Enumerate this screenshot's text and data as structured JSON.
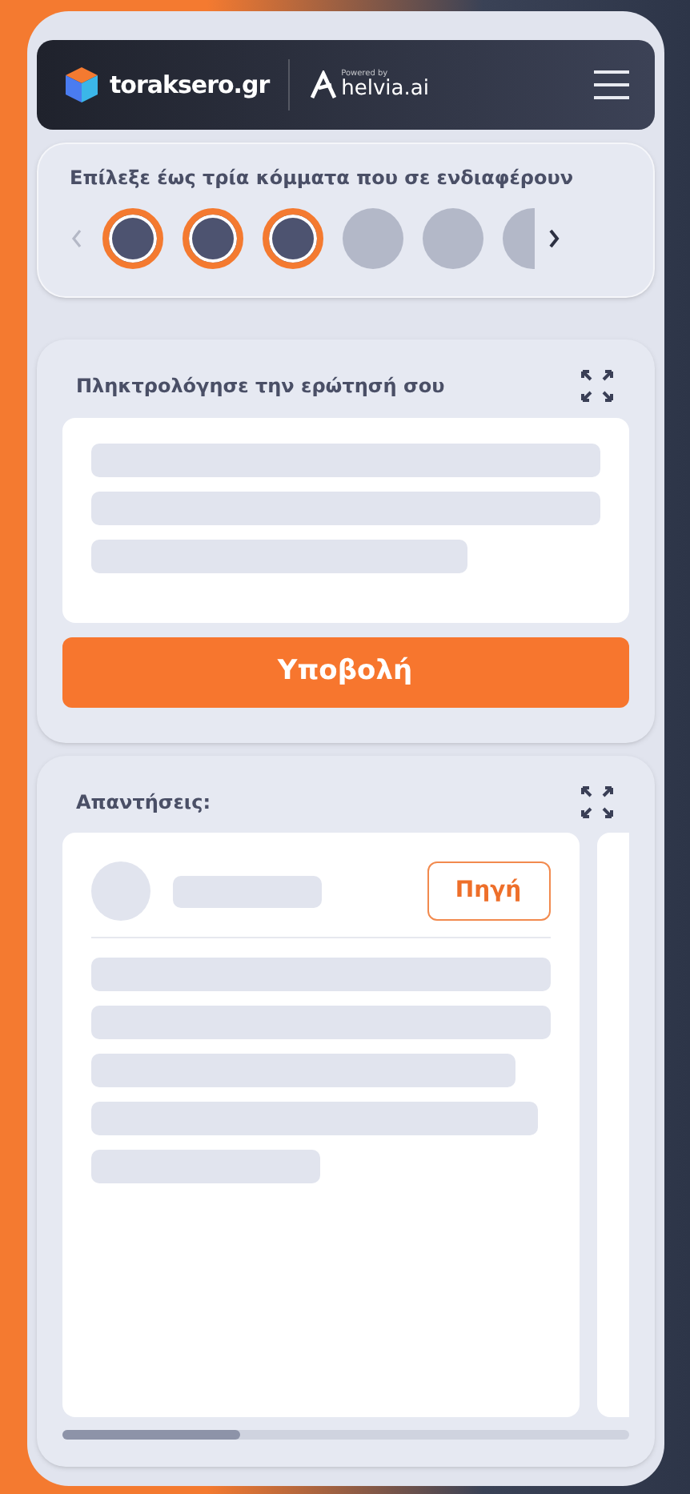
{
  "header": {
    "brand": "toraksero.gr",
    "powered_by": "Powered by",
    "partner": "helvia.ai"
  },
  "party_picker": {
    "title": "Επίλεξε έως τρία κόμματα που σε ενδιαφέρουν",
    "parties": [
      {
        "selected": true
      },
      {
        "selected": true
      },
      {
        "selected": true
      },
      {
        "selected": false
      },
      {
        "selected": false
      },
      {
        "selected": false
      }
    ]
  },
  "question": {
    "title": "Πληκτρολόγησε την ερώτησή σου",
    "submit": "Υποβολή"
  },
  "answers": {
    "title": "Απαντήσεις:",
    "source_button": "Πηγή"
  }
}
